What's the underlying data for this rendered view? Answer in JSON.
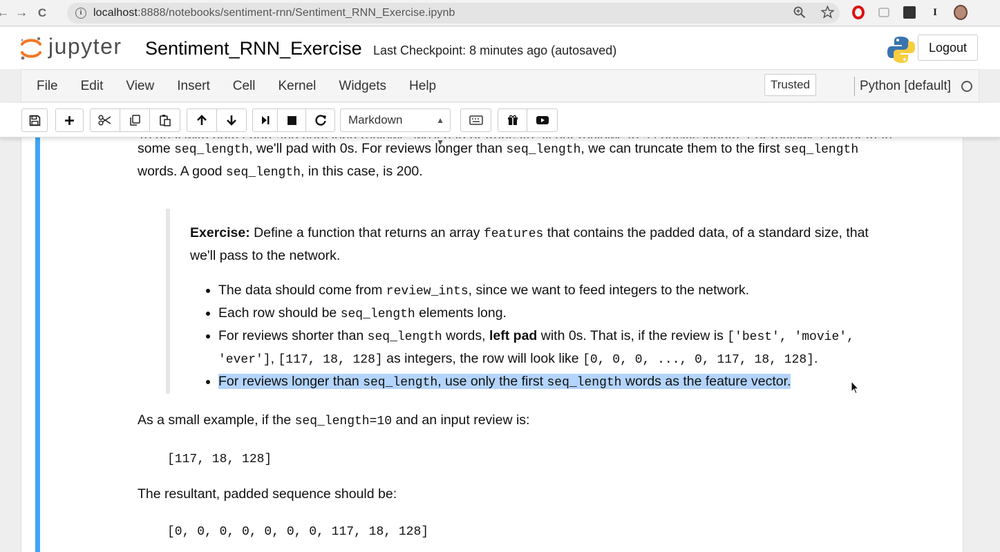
{
  "browser": {
    "back": "←",
    "forward": "→",
    "reload": "C",
    "url_host": "localhost",
    "url_path": ":8888/notebooks/sentiment-rnn/Sentiment_RNN_Exercise.ipynb",
    "zoom_icon": "zoom-icon",
    "star_icon": "star-icon"
  },
  "header": {
    "brand": "jupyter",
    "notebook_name": "Sentiment_RNN_Exercise",
    "checkpoint": "Last Checkpoint: 8 minutes ago (autosaved)",
    "logout": "Logout"
  },
  "menubar": {
    "items": [
      "File",
      "Edit",
      "View",
      "Insert",
      "Cell",
      "Kernel",
      "Widgets",
      "Help"
    ],
    "trusted": "Trusted",
    "kernel": "Python [default]"
  },
  "toolbar": {
    "cell_type": "Markdown",
    "buttons": [
      "save-icon",
      "plus-icon",
      "cut-icon",
      "copy-icon",
      "paste-icon",
      "arrow-up-icon",
      "arrow-down-icon",
      "run-icon",
      "stop-icon",
      "restart-icon",
      "keyboard-icon",
      "gift-icon",
      "youtube-icon"
    ]
  },
  "cell": {
    "intro_top": "To deal with both short and very long reviews, we'll pad or truncate all our reviews to a specific length. For reviews shorter than",
    "intro_1a": "some ",
    "intro_1b": "seq_length",
    "intro_1c": ", we'll pad with 0s. For reviews longer than ",
    "intro_1d": "seq_length",
    "intro_1e": ", we can truncate them to the first ",
    "intro_1f": "seq_length",
    "intro_2a": "words. A good ",
    "intro_2b": "seq_length",
    "intro_2c": ", in this case, is 200.",
    "exercise_label": "Exercise:",
    "exercise_a": " Define a function that returns an array ",
    "exercise_b": "features",
    "exercise_c": " that contains the padded data, of a standard size, that we'll pass to the network.",
    "b1a": "The data should come from ",
    "b1b": "review_ints",
    "b1c": ", since we want to feed integers to the network.",
    "b2a": "Each row should be ",
    "b2b": "seq_length",
    "b2c": " elements long.",
    "b3a": "For reviews shorter than ",
    "b3b": "seq_length",
    "b3c": " words, ",
    "b3d": "left pad",
    "b3e": " with 0s. That is, if the review is ",
    "b3f": "['best', 'movie', 'ever']",
    "b3g": ", ",
    "b3h": "[117, 18, 128]",
    "b3i": " as integers, the row will look like ",
    "b3j": "[0, 0, 0, ..., 0, 117, 18, 128]",
    "b3k": ".",
    "b4a": "For reviews longer than ",
    "b4b": "seq_length",
    "b4c": ", use only the first ",
    "b4d": "seq_length",
    "b4e": " words as the feature vector.",
    "ex_a": "As a small example, if the ",
    "ex_b": "seq_length=10",
    "ex_c": " and an input review is:",
    "ex_input": "[117, 18, 128]",
    "result_text": "The resultant, padded sequence should be:",
    "ex_output": "[0, 0, 0, 0, 0, 0, 0, 117, 18, 128]"
  },
  "colors": {
    "cell_selected": "#42a5f5",
    "highlight": "#b3d4fc",
    "jupyter_orange": "#f37726"
  }
}
